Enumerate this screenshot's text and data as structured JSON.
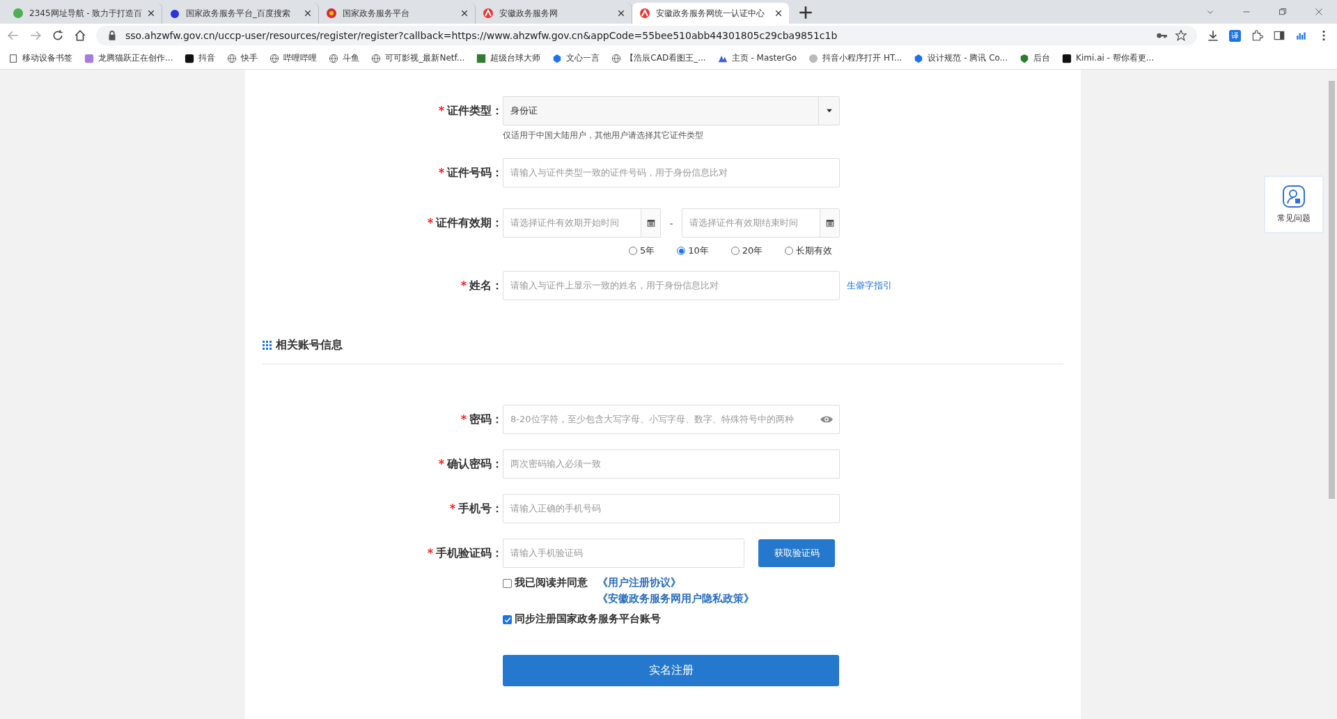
{
  "browser": {
    "tabs": [
      {
        "title": "2345网址导航 - 致力于打造百",
        "selected": false
      },
      {
        "title": "国家政务服务平台_百度搜索",
        "selected": false
      },
      {
        "title": "国家政务服务平台",
        "selected": false
      },
      {
        "title": "安徽政务服务网",
        "selected": false
      },
      {
        "title": "安徽政务服务网统一认证中心",
        "selected": true
      }
    ],
    "address": "sso.ahzwfw.gov.cn/uccp-user/resources/register/register?callback=https://www.ahzwfw.gov.cn&appCode=55bee510abb44301805c29cba9851c1b",
    "translate_badge": "译",
    "bookmarks": [
      "移动设备书签",
      "龙腾猫跃正在创作...",
      "抖音",
      "快手",
      "哔哩哔哩",
      "斗鱼",
      "可可影视_最新Netf...",
      "超级台球大师",
      "文心一言",
      "【浩辰CAD看图王_...",
      "主页 - MasterGo",
      "抖音小程序打开 HT...",
      "设计规范 - 腾讯 Co...",
      "后台",
      "Kimi.ai - 帮你看更..."
    ]
  },
  "form": {
    "identity_fields": [
      {
        "kind": "select",
        "required_mark": "*",
        "label": "证件类型：",
        "value": "身份证",
        "hint": "仅适用于中国大陆用户，其他用户请选择其它证件类型"
      },
      {
        "kind": "text",
        "required_mark": "*",
        "label": "证件号码：",
        "placeholder": "请输入与证件类型一致的证件号码，用于身份信息比对"
      },
      {
        "kind": "daterange",
        "required_mark": "*",
        "label": "证件有效期：",
        "start_placeholder": "请选择证件有效期开始时间",
        "separator": "-",
        "end_placeholder": "请选择证件有效期结束时间",
        "options": [
          {
            "label": "5年",
            "selected": false
          },
          {
            "label": "10年",
            "selected": true
          },
          {
            "label": "20年",
            "selected": false
          },
          {
            "label": "长期有效",
            "selected": false
          }
        ]
      },
      {
        "kind": "text",
        "required_mark": "*",
        "label": "姓名：",
        "placeholder": "请输入与证件上显示一致的姓名，用于身份信息比对",
        "link": "生僻字指引"
      }
    ],
    "section_title": "相关账号信息",
    "account_fields": [
      {
        "kind": "password",
        "required_mark": "*",
        "label": "密码：",
        "placeholder": "8-20位字符，至少包含大写字母、小写字母、数字、特殊符号中的两种"
      },
      {
        "kind": "text",
        "required_mark": "*",
        "label": "确认密码：",
        "placeholder": "两次密码输入必须一致"
      },
      {
        "kind": "text",
        "required_mark": "*",
        "label": "手机号：",
        "placeholder": "请输入正确的手机号码"
      },
      {
        "kind": "code",
        "required_mark": "*",
        "label": "手机验证码：",
        "placeholder": "请输入手机验证码",
        "button": "获取验证码"
      }
    ],
    "agreement": {
      "checked": false,
      "text": "我已阅读并同意",
      "links": [
        "《用户注册协议》",
        "《安徽政务服务网用户隐私政策》"
      ]
    },
    "sync": {
      "checked": true,
      "text": "同步注册国家政务服务平台账号"
    },
    "submit": "实名注册"
  },
  "help_widget": {
    "label": "常见问题"
  }
}
